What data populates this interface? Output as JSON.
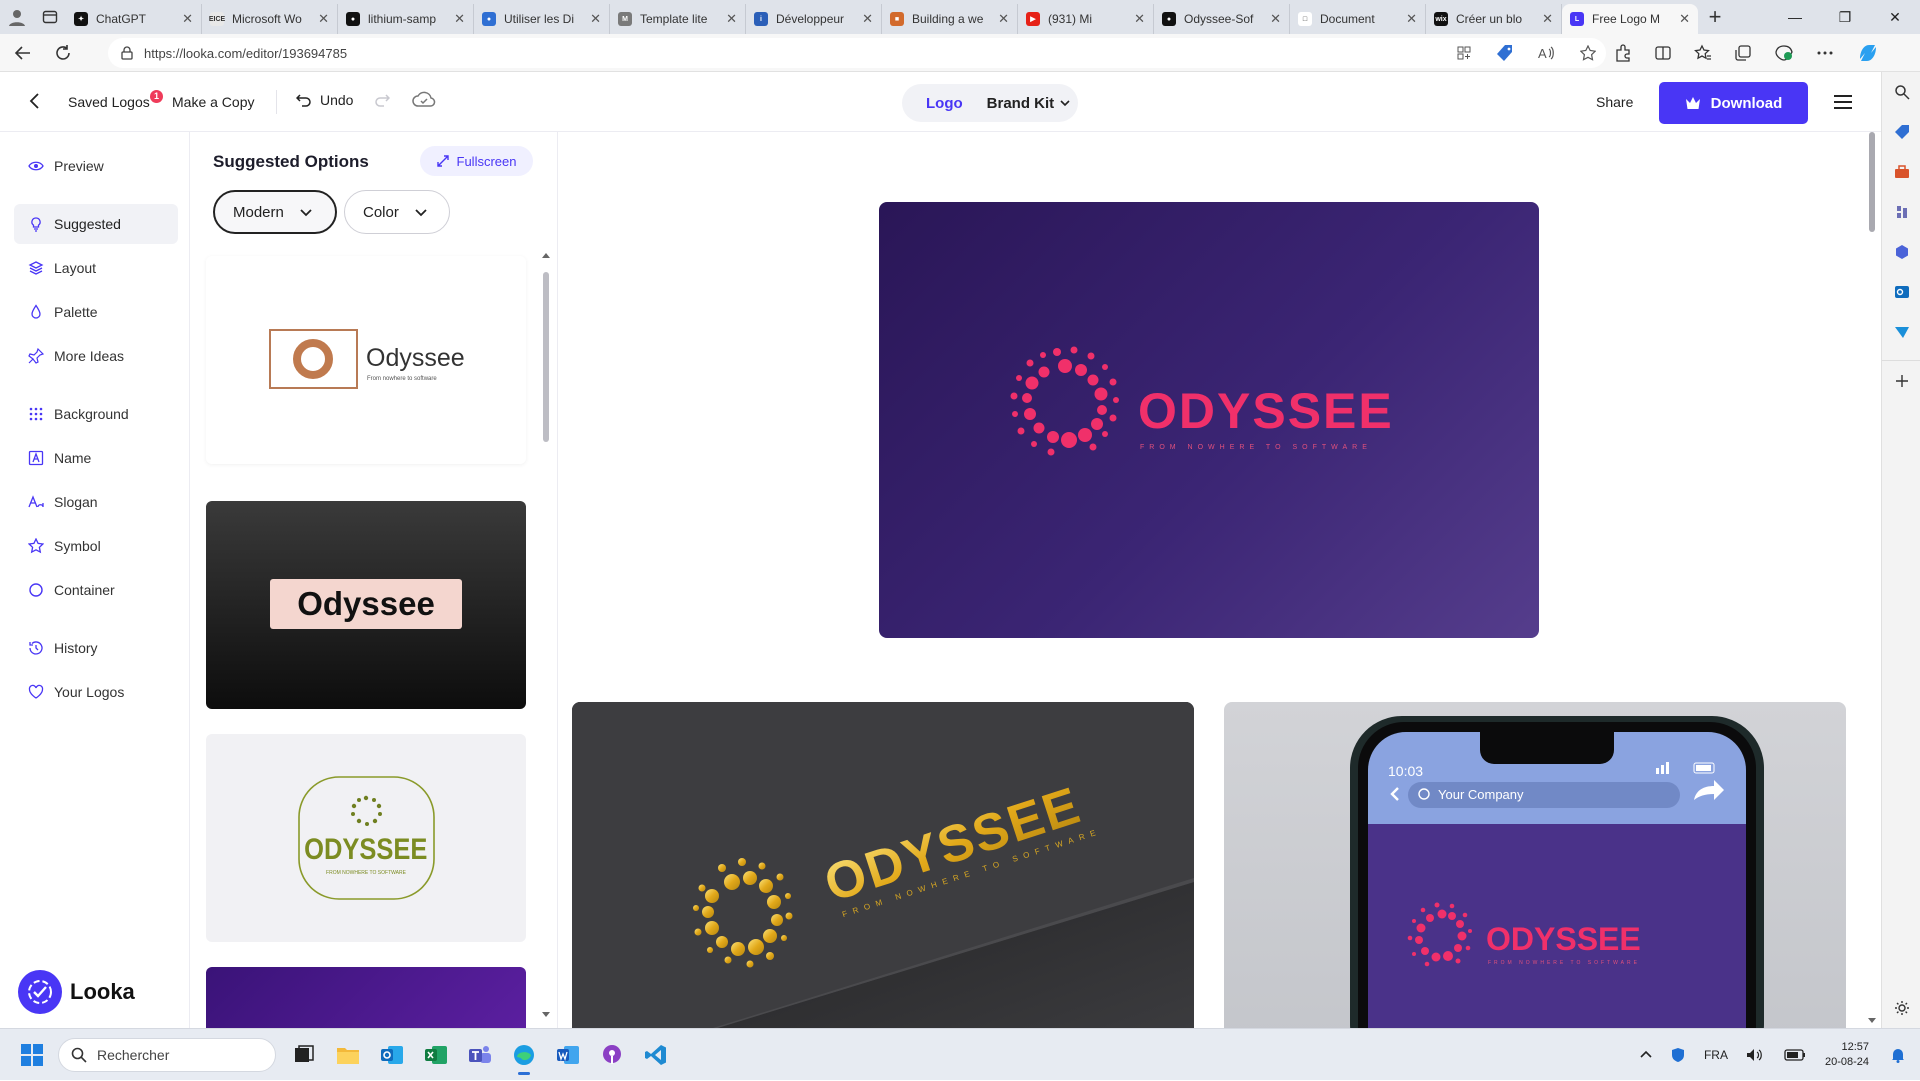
{
  "browser": {
    "tabs": [
      {
        "title": "ChatGPT",
        "fav_color": "#111111",
        "fav_char": "✦"
      },
      {
        "title": "Microsoft Wo",
        "fav_color": "#e8e8e8",
        "fav_char": "EICE"
      },
      {
        "title": "lithium-samp",
        "fav_color": "#111111",
        "fav_char": "●"
      },
      {
        "title": "Utiliser les Di",
        "fav_color": "#2f6fd3",
        "fav_char": "●"
      },
      {
        "title": "Template lite",
        "fav_color": "#7a7a7a",
        "fav_char": "M"
      },
      {
        "title": "Développeur",
        "fav_color": "#2b5fb8",
        "fav_char": "i"
      },
      {
        "title": "Building a we",
        "fav_color": "#d26a2c",
        "fav_char": "■"
      },
      {
        "title": "(931) Mi",
        "fav_color": "#e62117",
        "fav_char": "▶"
      },
      {
        "title": "Odyssee-Sof",
        "fav_color": "#111111",
        "fav_char": "●"
      },
      {
        "title": "Document",
        "fav_color": "#ffffff",
        "fav_char": "□"
      },
      {
        "title": "Créer un blo",
        "fav_color": "#111111",
        "fav_char": "wix"
      },
      {
        "title": "Free Logo M",
        "fav_color": "#4936f5",
        "fav_char": "L"
      }
    ],
    "new_tab": "+",
    "window_controls": [
      "—",
      "❐",
      "✕"
    ],
    "url": "https://looka.com/editor/193694785"
  },
  "header": {
    "saved_logos": "Saved Logos",
    "saved_badge": "1",
    "make_copy": "Make a Copy",
    "undo": "Undo",
    "tab_logo": "Logo",
    "tab_brand_kit": "Brand Kit",
    "share": "Share",
    "download": "Download"
  },
  "leftnav": {
    "items": [
      {
        "label": "Preview",
        "icon": "eye-icon"
      },
      {
        "label": "Suggested",
        "icon": "bulb-icon"
      },
      {
        "label": "Layout",
        "icon": "layers-icon"
      },
      {
        "label": "Palette",
        "icon": "drop-icon"
      },
      {
        "label": "More Ideas",
        "icon": "pin-icon"
      },
      {
        "label": "Background",
        "icon": "grid-icon"
      },
      {
        "label": "Name",
        "icon": "name-icon"
      },
      {
        "label": "Slogan",
        "icon": "slogan-icon"
      },
      {
        "label": "Symbol",
        "icon": "star-icon"
      },
      {
        "label": "Container",
        "icon": "circle-icon"
      },
      {
        "label": "History",
        "icon": "history-icon"
      },
      {
        "label": "Your Logos",
        "icon": "heart-icon"
      }
    ],
    "brand": "Looka"
  },
  "options": {
    "title": "Suggested Options",
    "fullscreen": "Fullscreen",
    "filter_style": "Modern",
    "filter_color": "Color",
    "cards": [
      {
        "name": "Odyssee",
        "tagline": "From nowhere to software"
      },
      {
        "name": "Odyssee"
      },
      {
        "name": "ODYSSEE",
        "tagline": "FROM NOWHERE TO SOFTWARE"
      }
    ]
  },
  "preview": {
    "name": "ODYSSEE",
    "tagline": "FROM NOWHERE TO SOFTWARE",
    "accent": "#f0306a",
    "gold": "#e6b31f",
    "phone_time": "10:03",
    "phone_search": "Your Company"
  },
  "taskbar": {
    "search": "Rechercher",
    "language": "FRA",
    "time": "12:57",
    "date": "20-08-24"
  }
}
